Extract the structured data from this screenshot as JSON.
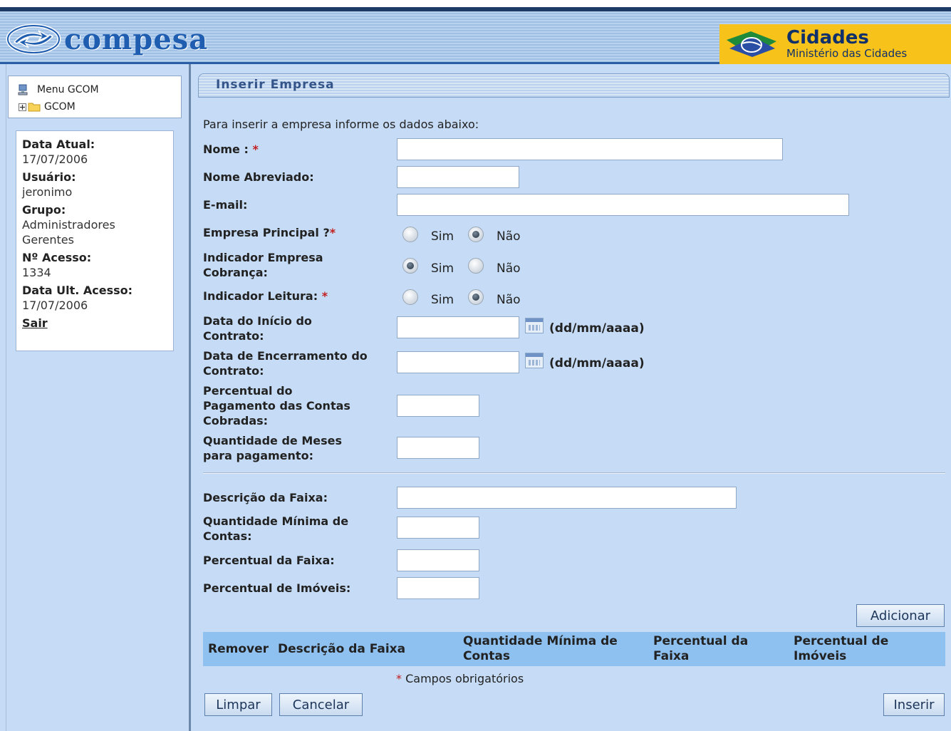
{
  "header": {
    "logo_text": "compesa",
    "cidades_title": "Cidades",
    "cidades_subtitle": "Ministério das Cidades"
  },
  "sidebar": {
    "menu_title": "Menu GCOM",
    "menu_folder": "GCOM",
    "info": {
      "data_atual_label": "Data Atual:",
      "data_atual_value": "17/07/2006",
      "usuario_label": "Usuário:",
      "usuario_value": "jeronimo",
      "grupo_label": "Grupo:",
      "grupo_value1": "Administradores",
      "grupo_value2": "Gerentes",
      "acesso_label": "Nº Acesso:",
      "acesso_value": "1334",
      "ult_acesso_label": "Data Ult. Acesso:",
      "ult_acesso_value": "17/07/2006",
      "sair": "Sair"
    }
  },
  "form": {
    "title": "Inserir Empresa",
    "intro": "Para inserir a empresa informe os dados abaixo:",
    "nome_label": "Nome :",
    "nome_abreviado_label": "Nome Abreviado:",
    "email_label": "E-mail:",
    "empresa_principal_label": "Empresa Principal ?",
    "indicador_cobranca_label1": "Indicador Empresa",
    "indicador_cobranca_label2": "Cobrança:",
    "indicador_leitura_label": "Indicador Leitura:",
    "data_inicio_label1": "Data do Início do",
    "data_inicio_label2": "Contrato:",
    "data_encerramento_label1": "Data de Encerramento do",
    "data_encerramento_label2": "Contrato:",
    "percentual_pagamento_label1": "Percentual do",
    "percentual_pagamento_label2": "Pagamento das Contas",
    "percentual_pagamento_label3": "Cobradas:",
    "qtd_meses_label1": "Quantidade de Meses",
    "qtd_meses_label2": "para pagamento:",
    "descricao_faixa_label": "Descrição da Faixa:",
    "qtd_minima_label1": "Quantidade Mínima de",
    "qtd_minima_label2": "Contas:",
    "percentual_faixa_label": "Percentual da Faixa:",
    "percentual_imoveis_label": "Percentual de Imóveis:",
    "required_mark": "*",
    "sim": "Sim",
    "nao": "Não",
    "date_format": "(dd/mm/aaaa)",
    "empresa_principal_selected": "Não",
    "indicador_cobranca_selected": "Sim",
    "indicador_leitura_selected": "Não"
  },
  "table": {
    "headers": [
      "Remover",
      "Descrição da Faixa",
      "Quantidade Mínima de Contas",
      "Percentual da Faixa",
      "Percentual de Imóveis"
    ]
  },
  "buttons": {
    "adicionar": "Adicionar",
    "limpar": "Limpar",
    "cancelar": "Cancelar",
    "inserir": "Inserir"
  },
  "footnote": "Campos obrigatórios"
}
